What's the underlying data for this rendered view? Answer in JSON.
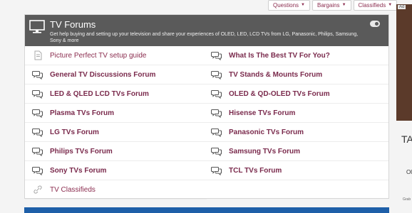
{
  "topnav": [
    {
      "label": "Questions"
    },
    {
      "label": "Bargains"
    },
    {
      "label": "Classifieds"
    }
  ],
  "panel": {
    "title": "TV Forums",
    "description": "Get help buying and setting up your television and share your experiences of OLED, LED, LCD TVs from LG, Panasonic, Philips, Samsung, Sony & more"
  },
  "forums": [
    {
      "label": "Picture Perfect TV setup guide",
      "icon": "document-icon",
      "style": "plain"
    },
    {
      "label": "What Is The Best TV For You?",
      "icon": "chat-bubbles-icon",
      "style": "bold"
    },
    {
      "label": "General TV Discussions Forum",
      "icon": "chat-bubbles-icon",
      "style": "bold"
    },
    {
      "label": "TV Stands & Mounts Forum",
      "icon": "chat-bubbles-icon",
      "style": "bold"
    },
    {
      "label": "LED & QLED LCD TVs Forum",
      "icon": "chat-bubbles-icon",
      "style": "bold"
    },
    {
      "label": "OLED & QD-OLED TVs Forum",
      "icon": "chat-bubbles-icon",
      "style": "bold"
    },
    {
      "label": "Plasma TVs Forum",
      "icon": "chat-bubbles-icon",
      "style": "bold"
    },
    {
      "label": "Hisense TVs Forum",
      "icon": "chat-bubbles-icon",
      "style": "bold"
    },
    {
      "label": "LG TVs Forum",
      "icon": "chat-bubbles-icon",
      "style": "bold"
    },
    {
      "label": "Panasonic TVs Forum",
      "icon": "chat-bubbles-icon",
      "style": "bold"
    },
    {
      "label": "Philips TVs Forum",
      "icon": "chat-bubbles-icon",
      "style": "bold"
    },
    {
      "label": "Samsung TVs Forum",
      "icon": "chat-bubbles-icon",
      "style": "bold"
    },
    {
      "label": "Sony TVs Forum",
      "icon": "chat-bubbles-icon",
      "style": "bold"
    },
    {
      "label": "TCL TVs Forum",
      "icon": "chat-bubbles-icon",
      "style": "bold"
    },
    {
      "label": "TV Classifieds",
      "icon": "link-icon",
      "style": "plain"
    }
  ],
  "sidebar": {
    "ad_badge": "Ad",
    "text1": "TA",
    "text2": "Ol",
    "text3": "Grab"
  },
  "colors": {
    "header_bg": "#5a5a5a",
    "link": "#7a2a4c",
    "bottom_bar": "#1e5fa8"
  }
}
